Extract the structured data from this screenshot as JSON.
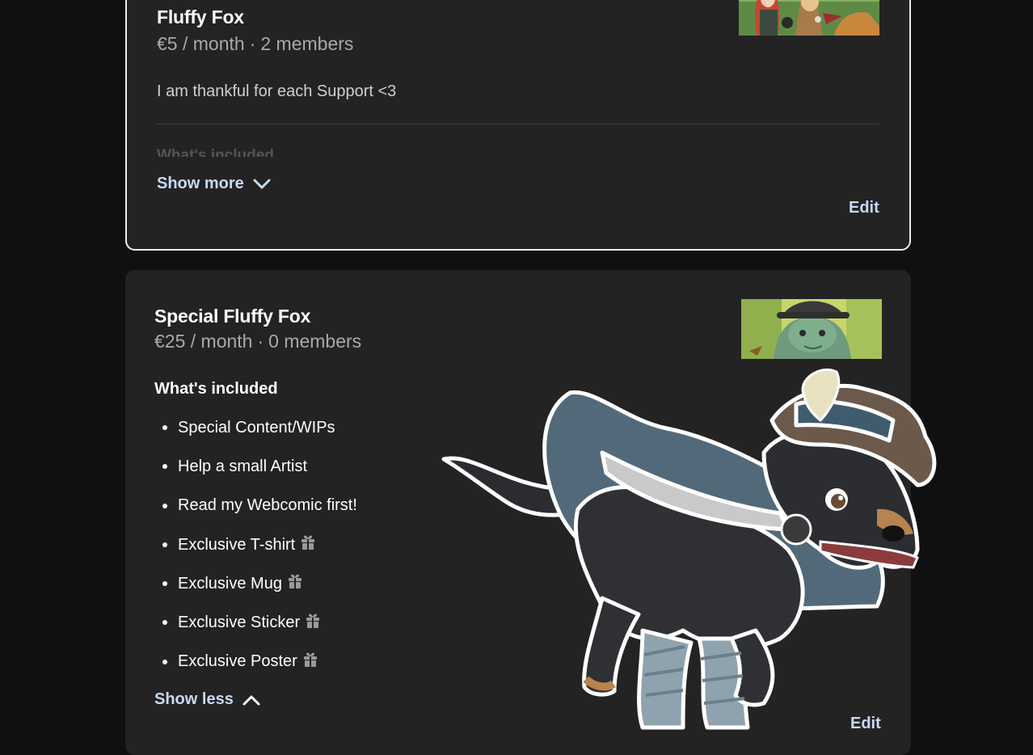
{
  "tiers": [
    {
      "title": "Fluffy Fox",
      "price": "€5 / month",
      "members": "2 members",
      "description": "I am thankful for each Support <3",
      "faded_heading": "What's included",
      "toggle_label": "Show more",
      "edit_label": "Edit"
    },
    {
      "title": "Special Fluffy Fox",
      "price": "€25 / month",
      "members": "0 members",
      "included_heading": "What's included",
      "benefits": [
        {
          "label": "Special Content/WIPs",
          "icon": null
        },
        {
          "label": "Help a small Artist",
          "icon": null
        },
        {
          "label": "Read my Webcomic first!",
          "icon": null
        },
        {
          "label": "Exclusive T-shirt",
          "icon": "gift-icon"
        },
        {
          "label": "Exclusive Mug",
          "icon": "gift-icon"
        },
        {
          "label": "Exclusive Sticker",
          "icon": "gift-icon"
        },
        {
          "label": "Exclusive Poster",
          "icon": "gift-icon"
        }
      ],
      "toggle_label": "Show less",
      "edit_label": "Edit"
    }
  ],
  "meta_separator": "·",
  "colors": {
    "page_background": "#101010",
    "card_background": "#232323",
    "selected_border": "#e9eef7",
    "link": "#c9d8f5",
    "muted_text": "#a9a9a9"
  }
}
